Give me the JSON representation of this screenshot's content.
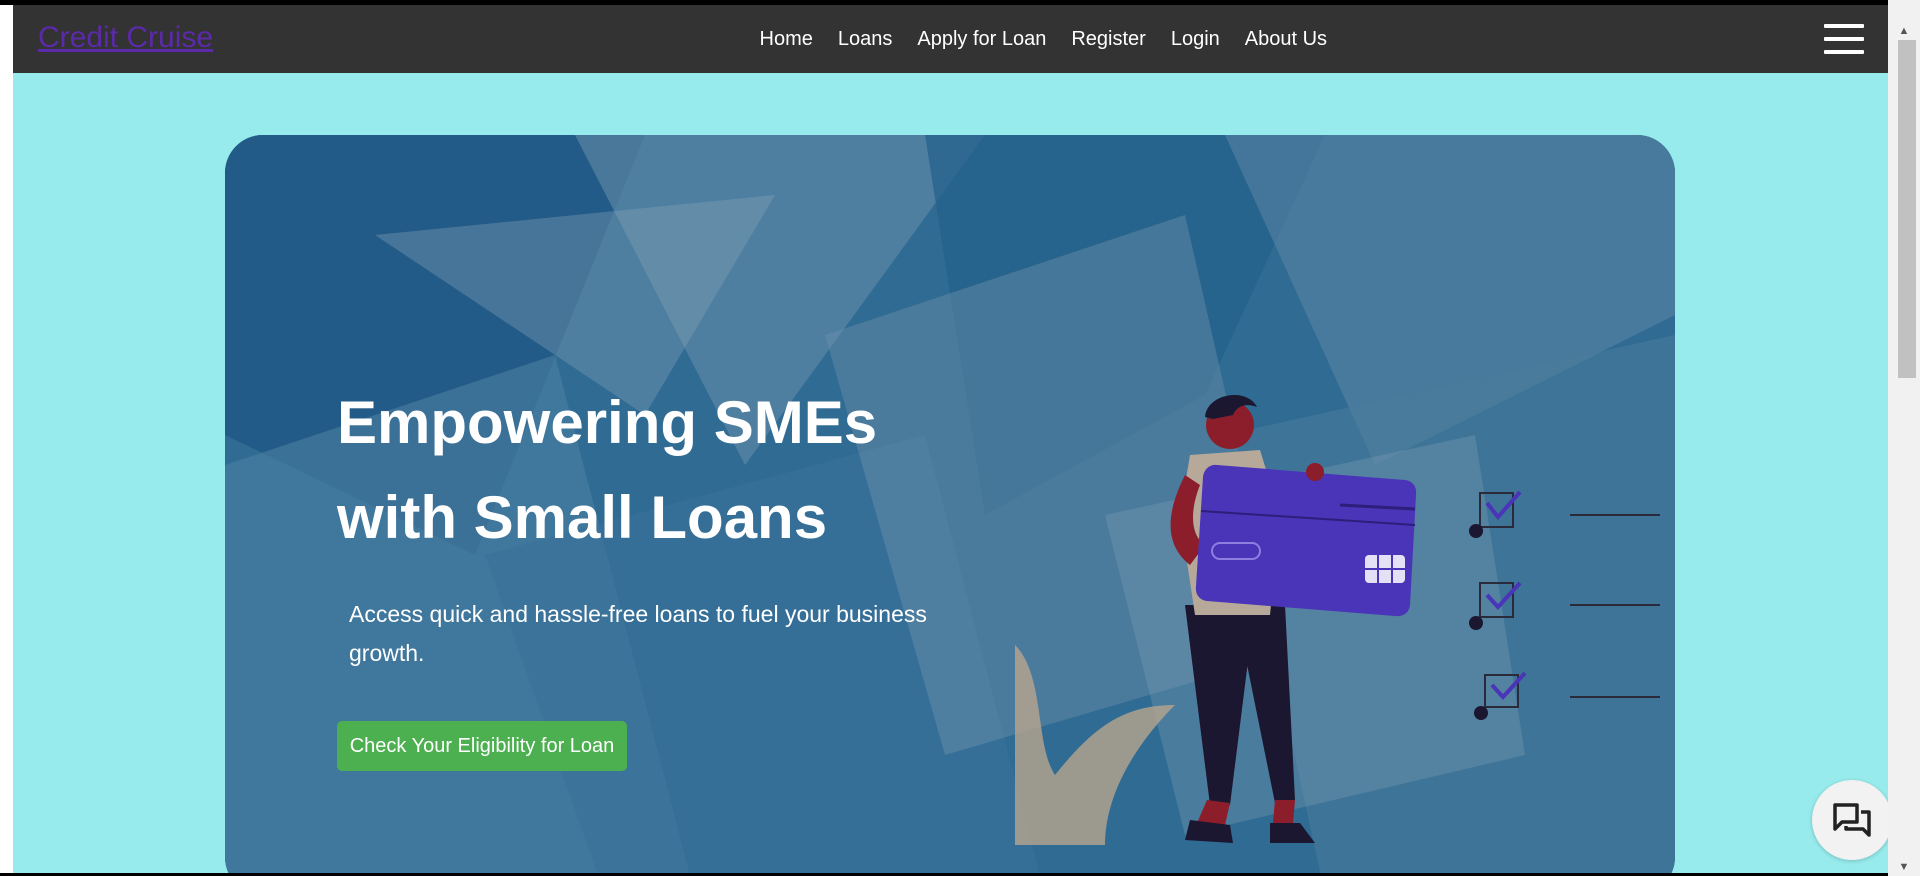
{
  "navbar": {
    "brand": "Credit Cruise",
    "links": [
      "Home",
      "Loans",
      "Apply for Loan",
      "Register",
      "Login",
      "About Us"
    ]
  },
  "hero": {
    "title_line1": "Empowering SMEs",
    "title_line2": "with Small Loans",
    "subtitle": "Access quick and hassle-free loans to fuel your business growth.",
    "cta_label": "Check Your Eligibility for Loan"
  },
  "colors": {
    "page_bg": "#97ebec",
    "navbar_bg": "#333333",
    "brand_link": "#5b2aa8",
    "cta_bg": "#4caf50",
    "hero_bg": "#2d6a94",
    "card_purple": "#4a34b8"
  },
  "icons": {
    "menu": "hamburger-icon",
    "chat": "chat-bubbles-icon",
    "checklist": "checkbox-check-icon"
  }
}
